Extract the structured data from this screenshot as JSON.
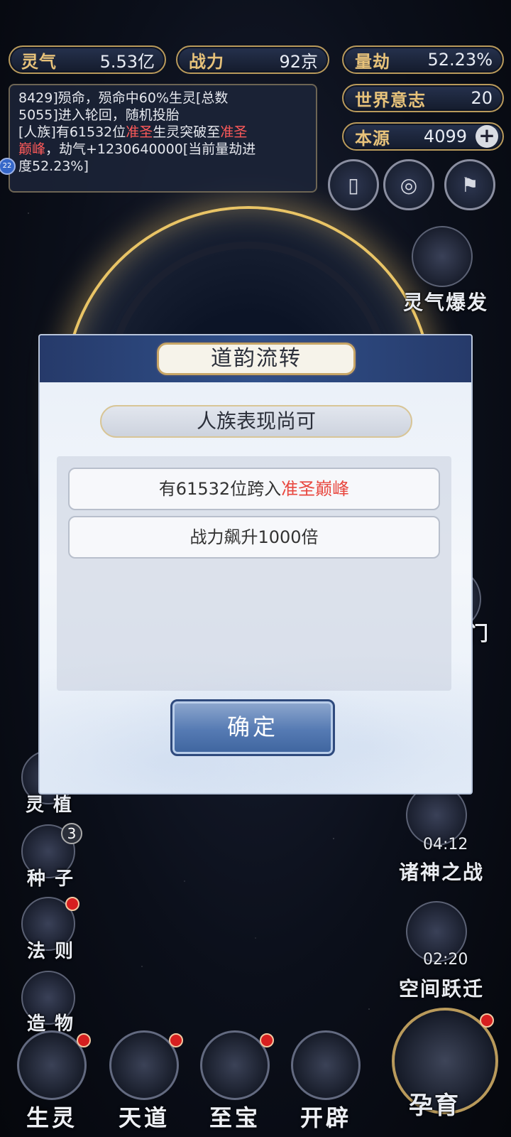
{
  "stats": {
    "lingqi": {
      "label": "灵气",
      "value": "5.53亿"
    },
    "zhanli": {
      "label": "战力",
      "value": "92京"
    },
    "liangjie": {
      "label": "量劫",
      "value": "52.23%"
    },
    "shijie": {
      "label": "世界意志",
      "value": "20"
    },
    "benyuan": {
      "label": "本源",
      "value": "4099",
      "plus": "+"
    }
  },
  "log": {
    "line1": "8429]殒命，殒命中60%生灵[总数",
    "line2": "5055]进入轮回，随机投胎",
    "line3_pre": "[人族]有61532位",
    "line3_red1": "准圣",
    "line3_mid": "生灵突破至",
    "line3_red2": "准圣",
    "line4_red": "巅峰",
    "line4_post": "，劫气+1230640000[当前量劫进",
    "line5": "度52.23%]",
    "side_badge": "22"
  },
  "right_buttons": {
    "burst": "灵气爆发",
    "war": "诸神之战",
    "war_timer": "04:12",
    "jump": "空间跃迁",
    "jump_timer": "02:20",
    "partial_men": "门"
  },
  "left_buttons": {
    "zhi": "灵 植",
    "seed": "种 子",
    "seed_count": "3",
    "law": "法 则",
    "item": "造 物"
  },
  "dialog": {
    "title": "道韵流转",
    "subtitle": "人族表现尚可",
    "row1_pre": "有61532位跨入",
    "row1_red": "准圣巅峰",
    "row2": "战力飙升1000倍",
    "confirm": "确定"
  },
  "nav": {
    "shengling": "生灵",
    "tiandao": "天道",
    "zhibao": "至宝",
    "kaipi": "开辟",
    "yunyu": "孕育"
  },
  "colors": {
    "gold": "#e7c27a",
    "red": "#e8473f",
    "accent": "#557ab3"
  }
}
